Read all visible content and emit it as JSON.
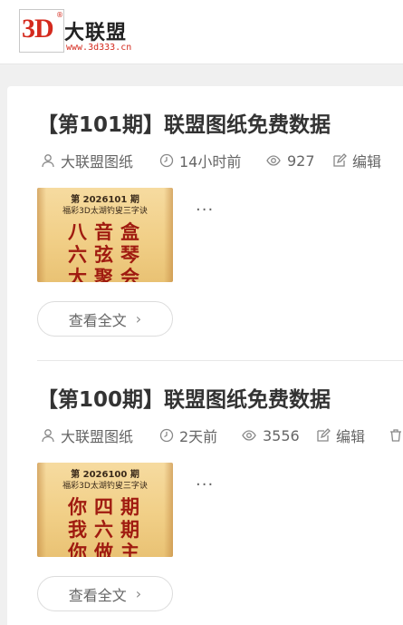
{
  "header": {
    "logo_text": "3D",
    "logo_reg": "®",
    "logo_name": "大联盟",
    "logo_url": "www.3d333.cn"
  },
  "articles": [
    {
      "title": "【第101期】联盟图纸免费数据",
      "author": "大联盟图纸",
      "time": "14小时前",
      "views": "927",
      "edit_label": "编辑",
      "thumb_issue": "第 2026101 期",
      "thumb_subtitle": "福彩3D太湖钓叟三字诀",
      "thumb_rows": [
        "八音盒",
        "六弦琴",
        "大聚会"
      ],
      "ellipsis": "...",
      "read_more": "查看全文"
    },
    {
      "title": "【第100期】联盟图纸免费数据",
      "author": "大联盟图纸",
      "time": "2天前",
      "views": "3556",
      "edit_label": "编辑",
      "thumb_issue": "第 2026100 期",
      "thumb_subtitle": "福彩3D太湖钓叟三字诀",
      "thumb_rows": [
        "你四期",
        "我六期",
        "你做主"
      ],
      "ellipsis": "...",
      "read_more": "查看全文"
    }
  ],
  "icons": {
    "author": "user-icon",
    "time": "clock-icon",
    "views": "eye-icon",
    "edit": "edit-icon",
    "delete": "trash-icon",
    "chevron": "chevron-right-icon"
  },
  "colors": {
    "brand_red": "#d42a1e",
    "background": "#f0f0f0",
    "card": "#ffffff",
    "thumb_red": "#a01b10"
  }
}
